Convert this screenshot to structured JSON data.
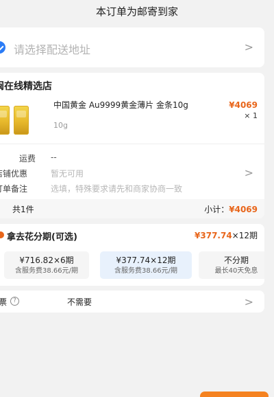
{
  "notice": "本订单为邮寄到家",
  "address": {
    "placeholder": "请选择配送地址",
    "chevron": ">"
  },
  "store": {
    "name": "闽在线精选店",
    "product": {
      "title": "中国黄金 Au9999黄金薄片 金条10g",
      "spec": "10g",
      "price": "¥4069",
      "quantity": "× 1"
    },
    "shipping": {
      "label": "运费",
      "value": "--"
    },
    "discount": {
      "label": "店铺优惠",
      "value": "暂无可用",
      "chevron": ">"
    },
    "remark": {
      "label": "订单备注",
      "placeholder": "选填，特殊要求请先和商家协商一致"
    },
    "total": {
      "count": "共1件",
      "subtotal_label": "小计：",
      "subtotal_value": "¥4069"
    }
  },
  "installment": {
    "title": "拿去花分期(可选)",
    "summary_amount": "¥377.74",
    "summary_term": "×12期",
    "plans": [
      {
        "main": "¥716.82×6期",
        "sub": "含服务费38.66元/期",
        "selected": false
      },
      {
        "main": "¥377.74×12期",
        "sub": "含服务费38.66元/期",
        "selected": true
      },
      {
        "main": "不分期",
        "sub": "最长40天免息",
        "selected": false
      }
    ]
  },
  "invoice": {
    "label": "票",
    "help_icon": "?",
    "value": "不需要",
    "chevron": ">"
  },
  "colors": {
    "accent_orange": "#e8651a",
    "accent_blue": "#2b7cf6",
    "background": "#f2f2f2"
  }
}
